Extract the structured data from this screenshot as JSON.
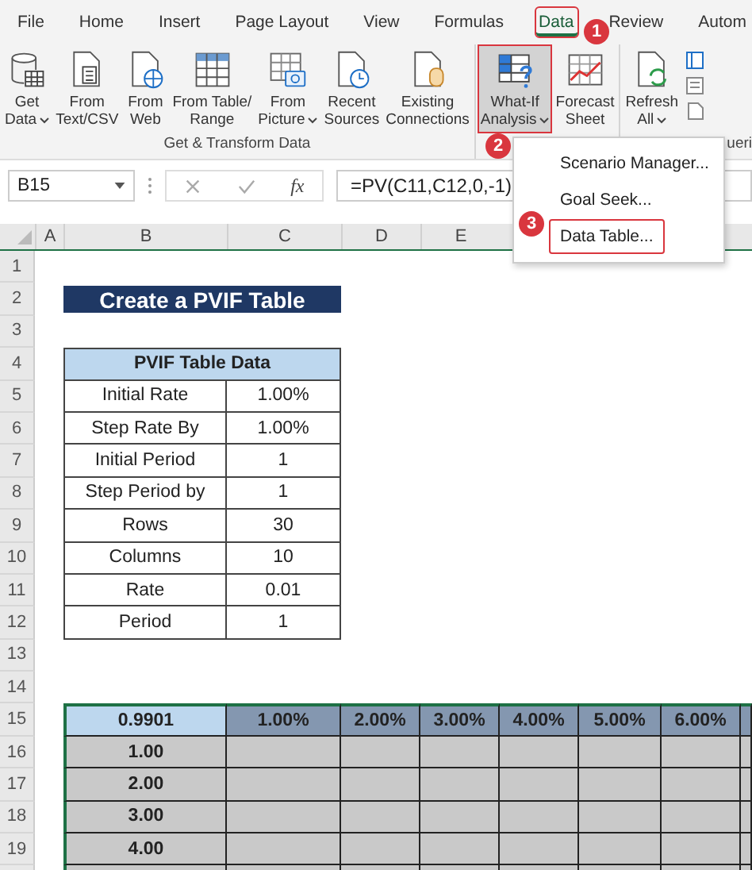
{
  "tabs": [
    {
      "label": "File",
      "selected": false
    },
    {
      "label": "Home",
      "selected": false
    },
    {
      "label": "Insert",
      "selected": false
    },
    {
      "label": "Page Layout",
      "selected": false
    },
    {
      "label": "View",
      "selected": false
    },
    {
      "label": "Formulas",
      "selected": false
    },
    {
      "label": "Data",
      "selected": true
    },
    {
      "label": "Review",
      "selected": false
    },
    {
      "label": "Autom",
      "selected": false
    }
  ],
  "ribbon": {
    "groups": [
      {
        "label": "Get & Transform Data",
        "buttons": [
          {
            "lines": [
              "Get",
              "Data"
            ],
            "dropdown": true,
            "highlighted": false
          },
          {
            "lines": [
              "From",
              "Text/CSV"
            ],
            "dropdown": false,
            "highlighted": false
          },
          {
            "lines": [
              "From",
              "Web"
            ],
            "dropdown": false,
            "highlighted": false
          },
          {
            "lines": [
              "From Table/",
              "Range"
            ],
            "dropdown": false,
            "highlighted": false
          },
          {
            "lines": [
              "From",
              "Picture"
            ],
            "dropdown": true,
            "highlighted": false
          },
          {
            "lines": [
              "Recent",
              "Sources"
            ],
            "dropdown": false,
            "highlighted": false
          },
          {
            "lines": [
              "Existing",
              "Connections"
            ],
            "dropdown": false,
            "highlighted": false
          }
        ]
      },
      {
        "buttons": [
          {
            "lines": [
              "What-If",
              "Analysis"
            ],
            "dropdown": true,
            "highlighted": true
          },
          {
            "lines": [
              "Forecast",
              "Sheet"
            ],
            "dropdown": false,
            "highlighted": false
          }
        ]
      },
      {
        "label": "ueri",
        "buttons": [
          {
            "lines": [
              "Refresh",
              "All"
            ],
            "dropdown": true,
            "highlighted": false
          }
        ]
      }
    ]
  },
  "menu": {
    "items": [
      {
        "label": "Scenario Manager...",
        "highlighted": false
      },
      {
        "label": "Goal Seek...",
        "highlighted": false
      },
      {
        "label": "Data Table...",
        "highlighted": true
      }
    ]
  },
  "callouts": [
    {
      "number": "1"
    },
    {
      "number": "2"
    },
    {
      "number": "3"
    }
  ],
  "formula_bar": {
    "name_box": "B15",
    "function_label": "fx",
    "formula": "=PV(C11,C12,0,-1)"
  },
  "sheet": {
    "column_headers": [
      "A",
      "B",
      "C",
      "D",
      "E"
    ],
    "row_numbers": [
      "1",
      "2",
      "3",
      "4",
      "5",
      "6",
      "7",
      "8",
      "9",
      "10",
      "11",
      "12",
      "13",
      "14",
      "15",
      "16",
      "17",
      "18",
      "19"
    ],
    "title": "Create a PVIF Table",
    "data_table": {
      "header": "PVIF Table Data",
      "rows": [
        {
          "label": "Initial Rate",
          "value": "1.00%"
        },
        {
          "label": "Step Rate By",
          "value": "1.00%"
        },
        {
          "label": "Initial Period",
          "value": "1"
        },
        {
          "label": "Step Period by",
          "value": "1"
        },
        {
          "label": "Rows",
          "value": "30"
        },
        {
          "label": "Columns",
          "value": "10"
        },
        {
          "label": "Rate",
          "value": "0.01"
        },
        {
          "label": "Period",
          "value": "1"
        }
      ]
    },
    "pvif_table": {
      "corner": "0.9901",
      "rate_headers": [
        "1.00%",
        "2.00%",
        "3.00%",
        "4.00%",
        "5.00%",
        "6.00%"
      ],
      "period_rows": [
        "1.00",
        "2.00",
        "3.00",
        "4.00"
      ]
    }
  }
}
